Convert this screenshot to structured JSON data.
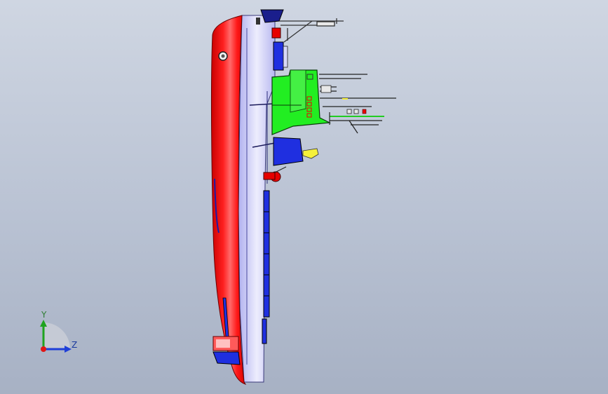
{
  "viewport": {
    "background_top": "#cfd6e2",
    "background_bottom": "#a7b1c4"
  },
  "model": {
    "colors": {
      "hull_red": "#ff1a1a",
      "hull_lavender": "#c9c9f3",
      "deck_green": "#22ee22",
      "structure_blue": "#1f2fe0",
      "accent_yellow": "#f5f03a"
    }
  },
  "triad": {
    "y_label": "Y",
    "z_label": "Z",
    "y_color": "#1fa31f",
    "z_color": "#1f3fd8",
    "origin_color": "#e01616"
  }
}
